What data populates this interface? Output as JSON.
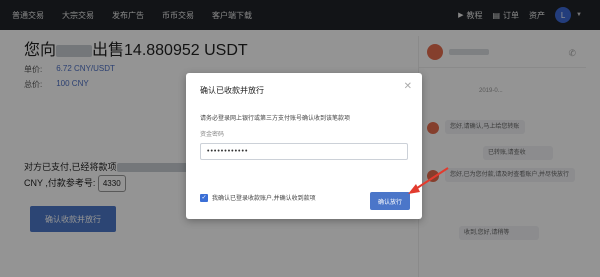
{
  "nav": {
    "items": [
      "普通交易",
      "大宗交易",
      "发布广告",
      "币币交易",
      "客户端下载"
    ],
    "tutorial": "教程",
    "orders": "订单",
    "assets": "资产",
    "avatar_letter": "L"
  },
  "order": {
    "title_prefix": "您向",
    "title_suffix": "出售14.880952 USDT",
    "price_label": "单价:",
    "price_value": "6.72 CNY/USDT",
    "total_label": "总价:",
    "total_value": "100 CNY",
    "payment_line1_prefix": "对方已支付,已经将款项",
    "payment_line2_prefix": "CNY ,付款参考号:",
    "reference_number": "4330",
    "primary_button": "确认收款并放行"
  },
  "chat": {
    "date": "2019-0...",
    "bubbles": [
      "您好,请确认,马上给您转账",
      "已转账,请查收",
      "您好,已为您付款,请及时查看账户,并尽快放行",
      "收到,您好,请稍等"
    ]
  },
  "modal": {
    "title": "确认已收款并放行",
    "hint": "请务必登录网上银行或第三方支付账号确认收到该笔款项",
    "password_label": "资金密码",
    "password_value": "••••••••••••",
    "checkbox_label": "我确认已登录收款账户,并确认收到款项",
    "confirm_button": "确认放行"
  },
  "colors": {
    "nav_bg": "#1f2329",
    "accent": "#4b76c9",
    "arrow": "#e23b2e"
  }
}
